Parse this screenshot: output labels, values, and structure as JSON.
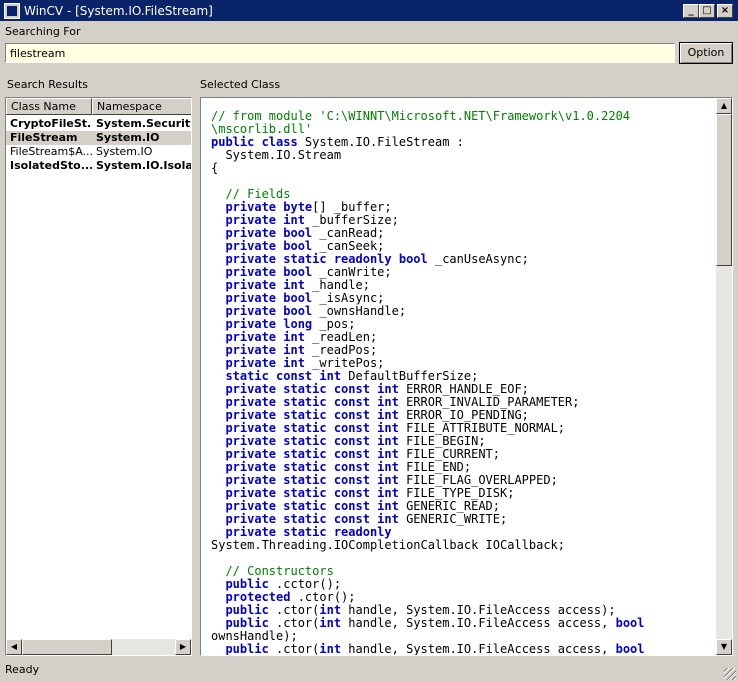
{
  "window": {
    "title": "WinCV - [System.IO.FileStream]"
  },
  "titlebar_buttons": {
    "minimize": "_",
    "maximize": "□",
    "close": "×"
  },
  "search": {
    "label": "Searching For",
    "value": "filestream",
    "option_label": "Option"
  },
  "results": {
    "label": "Search Results",
    "columns": [
      "Class Name",
      "Namespace"
    ],
    "rows": [
      {
        "class_name": "CryptoFileSt...",
        "namespace": "System.Security.",
        "bold": true,
        "selected": false
      },
      {
        "class_name": "FileStream",
        "namespace": "System.IO",
        "bold": true,
        "selected": true
      },
      {
        "class_name": "FileStream$A...",
        "namespace": "System.IO",
        "bold": false,
        "selected": false
      },
      {
        "class_name": "IsolatedSto...",
        "namespace": "System.IO.Isolat",
        "bold": true,
        "selected": false
      }
    ]
  },
  "selected": {
    "label": "Selected Class",
    "code": [
      [
        [
          "cm",
          "// from module 'C:\\WINNT\\Microsoft.NET\\Framework\\v1.0.2204"
        ]
      ],
      [
        [
          "cm",
          "\\mscorlib.dll'"
        ]
      ],
      [
        [
          "kw",
          "public class "
        ],
        [
          "t",
          "System.IO.FileStream :"
        ]
      ],
      [
        [
          "t",
          "  System.IO.Stream"
        ]
      ],
      [
        [
          "t",
          "{"
        ]
      ],
      [
        [
          "t",
          ""
        ]
      ],
      [
        [
          "cm",
          "  // Fields"
        ]
      ],
      [
        [
          "kw",
          "  private byte"
        ],
        [
          "t",
          "[] _buffer;"
        ]
      ],
      [
        [
          "kw",
          "  private int "
        ],
        [
          "t",
          "_bufferSize;"
        ]
      ],
      [
        [
          "kw",
          "  private bool "
        ],
        [
          "t",
          "_canRead;"
        ]
      ],
      [
        [
          "kw",
          "  private bool "
        ],
        [
          "t",
          "_canSeek;"
        ]
      ],
      [
        [
          "kw",
          "  private static readonly bool "
        ],
        [
          "t",
          "_canUseAsync;"
        ]
      ],
      [
        [
          "kw",
          "  private bool "
        ],
        [
          "t",
          "_canWrite;"
        ]
      ],
      [
        [
          "kw",
          "  private int "
        ],
        [
          "t",
          "_handle;"
        ]
      ],
      [
        [
          "kw",
          "  private bool "
        ],
        [
          "t",
          "_isAsync;"
        ]
      ],
      [
        [
          "kw",
          "  private bool "
        ],
        [
          "t",
          "_ownsHandle;"
        ]
      ],
      [
        [
          "kw",
          "  private long "
        ],
        [
          "t",
          "_pos;"
        ]
      ],
      [
        [
          "kw",
          "  private int "
        ],
        [
          "t",
          "_readLen;"
        ]
      ],
      [
        [
          "kw",
          "  private int "
        ],
        [
          "t",
          "_readPos;"
        ]
      ],
      [
        [
          "kw",
          "  private int "
        ],
        [
          "t",
          "_writePos;"
        ]
      ],
      [
        [
          "kw",
          "  static const int "
        ],
        [
          "t",
          "DefaultBufferSize;"
        ]
      ],
      [
        [
          "kw",
          "  private static const int "
        ],
        [
          "t",
          "ERROR_HANDLE_EOF;"
        ]
      ],
      [
        [
          "kw",
          "  private static const int "
        ],
        [
          "t",
          "ERROR_INVALID_PARAMETER;"
        ]
      ],
      [
        [
          "kw",
          "  private static const int "
        ],
        [
          "t",
          "ERROR_IO_PENDING;"
        ]
      ],
      [
        [
          "kw",
          "  private static const int "
        ],
        [
          "t",
          "FILE_ATTRIBUTE_NORMAL;"
        ]
      ],
      [
        [
          "kw",
          "  private static const int "
        ],
        [
          "t",
          "FILE_BEGIN;"
        ]
      ],
      [
        [
          "kw",
          "  private static const int "
        ],
        [
          "t",
          "FILE_CURRENT;"
        ]
      ],
      [
        [
          "kw",
          "  private static const int "
        ],
        [
          "t",
          "FILE_END;"
        ]
      ],
      [
        [
          "kw",
          "  private static const int "
        ],
        [
          "t",
          "FILE_FLAG_OVERLAPPED;"
        ]
      ],
      [
        [
          "kw",
          "  private static const int "
        ],
        [
          "t",
          "FILE_TYPE_DISK;"
        ]
      ],
      [
        [
          "kw",
          "  private static const int "
        ],
        [
          "t",
          "GENERIC_READ;"
        ]
      ],
      [
        [
          "kw",
          "  private static const int "
        ],
        [
          "t",
          "GENERIC_WRITE;"
        ]
      ],
      [
        [
          "kw",
          "  private static readonly"
        ]
      ],
      [
        [
          "t",
          "System.Threading.IOCompletionCallback IOCallback;"
        ]
      ],
      [
        [
          "t",
          ""
        ]
      ],
      [
        [
          "cm",
          "  // Constructors"
        ]
      ],
      [
        [
          "kw",
          "  public "
        ],
        [
          "t",
          ".cctor();"
        ]
      ],
      [
        [
          "kw",
          "  protected "
        ],
        [
          "t",
          ".ctor();"
        ]
      ],
      [
        [
          "kw",
          "  public "
        ],
        [
          "t",
          ".ctor("
        ],
        [
          "kw",
          "int "
        ],
        [
          "t",
          "handle, System.IO.FileAccess access);"
        ]
      ],
      [
        [
          "kw",
          "  public "
        ],
        [
          "t",
          ".ctor("
        ],
        [
          "kw",
          "int "
        ],
        [
          "t",
          "handle, System.IO.FileAccess access, "
        ],
        [
          "kw",
          "bool"
        ]
      ],
      [
        [
          "t",
          "ownsHandle);"
        ]
      ],
      [
        [
          "kw",
          "  public "
        ],
        [
          "t",
          ".ctor("
        ],
        [
          "kw",
          "int "
        ],
        [
          "t",
          "handle, System.IO.FileAccess access, "
        ],
        [
          "kw",
          "bool"
        ]
      ]
    ]
  },
  "scroll": {
    "vertical_position": 0.0,
    "horizontal_position": 0.0
  },
  "status": {
    "text": "Ready"
  },
  "colors": {
    "titlebar": "#0a246a",
    "keyword": "#0000cc",
    "comment": "#008000",
    "input_bg": "#ffffe1",
    "face": "#d4d0c8"
  }
}
